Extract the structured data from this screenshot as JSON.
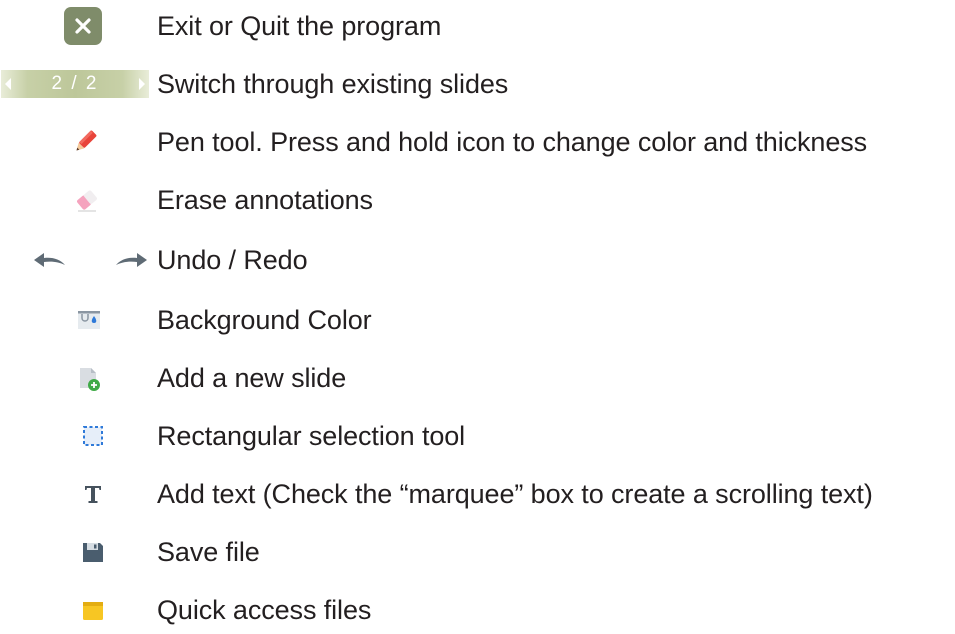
{
  "legend": {
    "rows": [
      {
        "icon": "close-icon",
        "label": "Exit or Quit the program"
      },
      {
        "icon": "slide-switcher",
        "counter": "2 / 2",
        "label": "Switch through existing slides"
      },
      {
        "icon": "pen-icon",
        "label": "Pen tool. Press and hold icon to change color and thickness"
      },
      {
        "icon": "eraser-icon",
        "label": "Erase annotations"
      },
      {
        "icon": "undo-redo-icons",
        "label": "Undo / Redo"
      },
      {
        "icon": "background-color-icon",
        "label": "Background Color"
      },
      {
        "icon": "add-slide-icon",
        "label": "Add a new slide"
      },
      {
        "icon": "rectangular-selection-icon",
        "label": "Rectangular selection tool"
      },
      {
        "icon": "text-icon",
        "label": "Add text (Check the “marquee” box to create a scrolling text)"
      },
      {
        "icon": "save-icon",
        "label": "Save file"
      },
      {
        "icon": "folder-icon",
        "label": "Quick access files"
      }
    ]
  },
  "colors": {
    "exit_bg": "#7f8c6a",
    "slider_bg": "#bdc79a",
    "pen": "#e8443a",
    "eraser": "#f5a3be",
    "arrows": "#5f6b75",
    "blue": "#2f7ad9",
    "green": "#3faa47",
    "save": "#4a5d6e",
    "folder": "#f7c623"
  }
}
